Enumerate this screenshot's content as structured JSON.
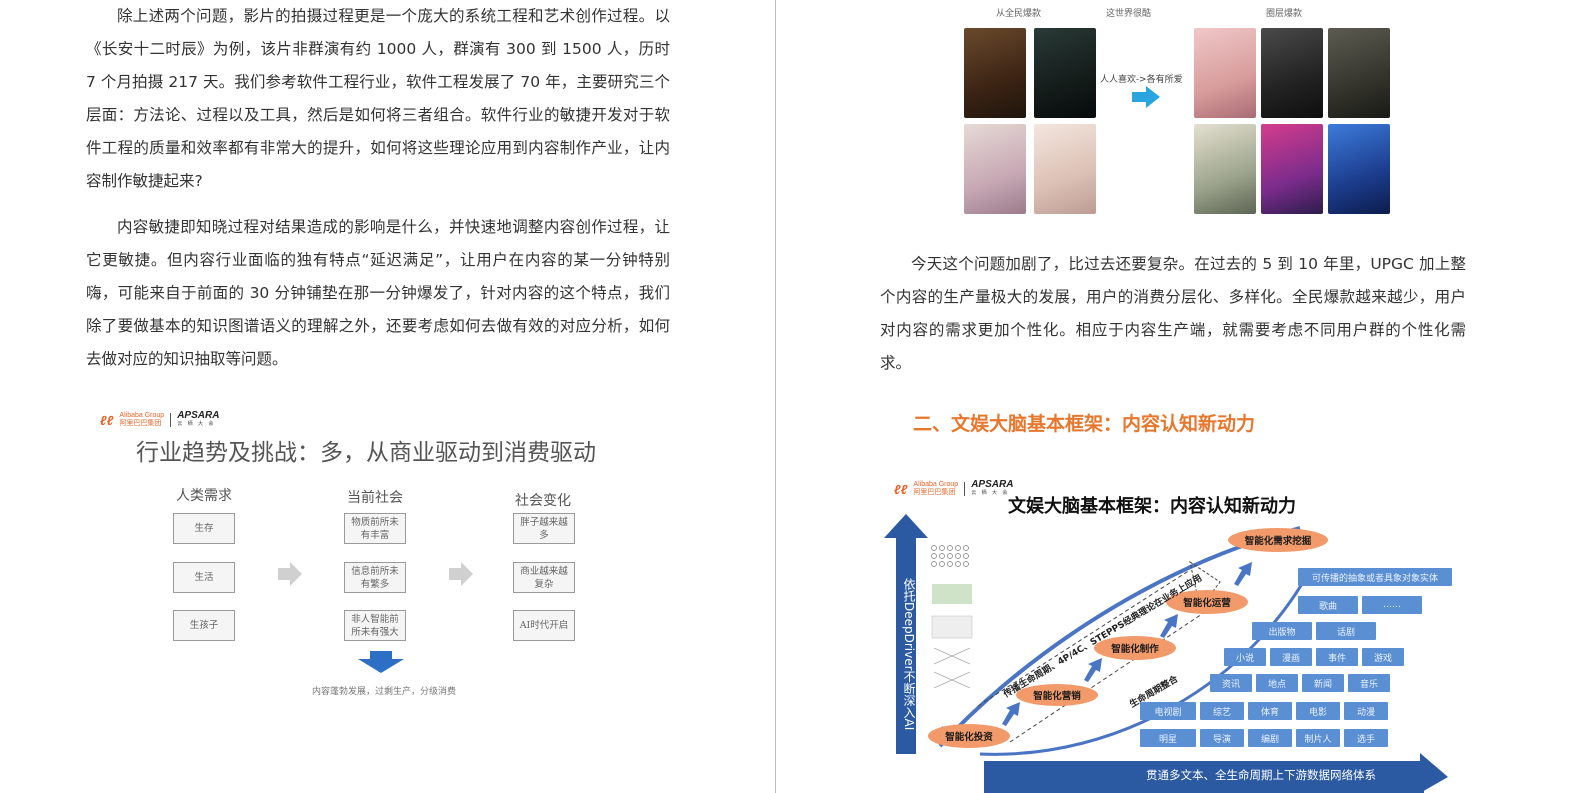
{
  "left": {
    "paragraphs": [
      "除上述两个问题，影片的拍摄过程更是一个庞大的系统工程和艺术创作过程。以《长安十二时辰》为例，该片非群演有约 1000 人，群演有 300 到 1500 人，历时 7 个月拍摄 217 天。我们参考软件工程行业，软件工程发展了 70 年，主要研究三个层面：方法论、过程以及工具，然后是如何将三者组合。软件行业的敏捷开发对于软件工程的质量和效率都有非常大的提升，如何将这些理论应用到内容制作产业，让内容制作敏捷起来?",
      "内容敏捷即知晓过程对结果造成的影响是什么，并快速地调整内容创作过程，让它更敏捷。但内容行业面临的独有特点“延迟满足”，让用户在内容的某一分钟特别嗨，可能来自于前面的 30 分钟铺垫在那一分钟爆发了，针对内容的这个特点，我们除了要做基本的知识图谱语义的理解之外，还要考虑如何去做有效的对应分析，如何去做对应的知识抽取等问题。"
    ],
    "slide": {
      "logo": {
        "brand": "Alibaba Group",
        "brand_cn": "阿里巴巴集团",
        "event": "APSARA",
        "event_cn": "云 栖 大 会"
      },
      "title": "行业趋势及挑战：多，从商业驱动到消费驱动",
      "columns": [
        {
          "header": "人类需求",
          "items": [
            "生存",
            "生活",
            "生孩子"
          ]
        },
        {
          "header": "当前社会",
          "items": [
            "物质前所未有丰富",
            "信息前所未有繁多",
            "非人智能前所未有强大"
          ]
        },
        {
          "header": "社会变化",
          "items": [
            "胖子越来越多",
            "商业越来越复杂",
            "AI时代开启"
          ]
        }
      ],
      "caption": "内容蓬勃发展，过剩生产，分级消费"
    }
  },
  "right": {
    "poster_figure": {
      "label_left": "从全民爆款",
      "label_mid": "这世界很酷",
      "label_right": "圈层爆款",
      "arrow_label": "人人喜欢->各有所爱",
      "left_posters": [
        "",
        "",
        "",
        ""
      ],
      "right_posters": [
        "",
        "",
        "",
        "",
        "",
        ""
      ]
    },
    "paragraph": "今天这个问题加剧了，比过去还要复杂。在过去的 5 到 10 年里，UPGC 加上整个内容的生产量极大的发展，用户的消费分层化、多样化。全民爆款越来越少，用户对内容的需求更加个性化。相应于内容生产端，就需要考虑不同用户群的个性化需求。",
    "section_heading": "二、文娱大脑基本框架：内容认知新动力",
    "slide": {
      "logo": {
        "brand": "Alibaba Group",
        "brand_cn": "阿里巴巴集团",
        "event": "APSARA",
        "event_cn": "云 栖 大 会"
      },
      "title": "文娱大脑基本框架：内容认知新动力",
      "vertical_bar": "依托DeepDriver不断深入AI",
      "bottom_bar": "贯通多文本、全生命周期上下游数据网络体系",
      "stages": [
        "智能化投资",
        "智能化营销",
        "智能化制作",
        "智能化运营",
        "智能化需求挖掘"
      ],
      "diagonal_label": "传播生命周期、4P/4C、STEPPS经典理论在业务上应用",
      "cycle_label": "生命周期整合",
      "blocks": {
        "row1": [
          "可传播的抽象或者具象对象实体"
        ],
        "row2": [
          "歌曲",
          "……"
        ],
        "row3": [
          "出版物",
          "话剧"
        ],
        "row4": [
          "小说",
          "漫画",
          "事件",
          "游戏"
        ],
        "row5": [
          "资讯",
          "地点",
          "新闻",
          "音乐"
        ],
        "row6": [
          "电视剧",
          "综艺",
          "体育",
          "电影",
          "动漫"
        ],
        "row7": [
          "明星",
          "导演",
          "编剧",
          "制片人",
          "选手"
        ]
      },
      "colors": {
        "bar_blue": "#2b5aa3",
        "block_blue": "#5b8fd3",
        "oval_orange": "#f29a6a",
        "heading_orange": "#e8772e"
      }
    }
  }
}
